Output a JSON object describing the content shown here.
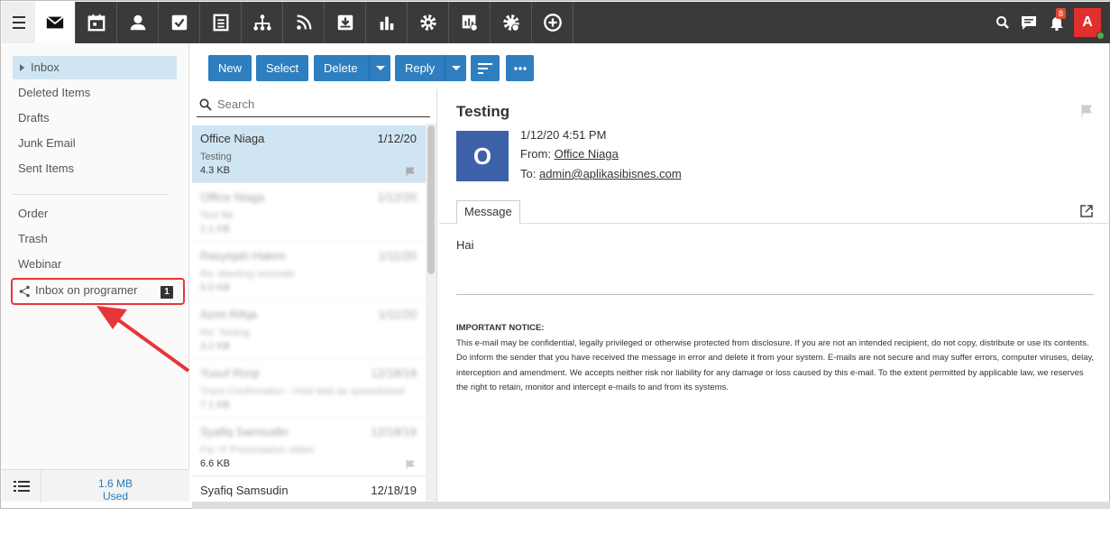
{
  "topbar": {
    "apps": [
      "mail-icon",
      "calendar-icon",
      "contacts-icon",
      "tasks-icon",
      "notes-icon",
      "org-chart-icon",
      "rss-icon",
      "archive-icon",
      "reports-icon",
      "settings-icon",
      "analytics-icon",
      "admin-settings-icon",
      "add-icon"
    ],
    "notification_count": "8",
    "user_initial": "A"
  },
  "folders": {
    "inbox": "Inbox",
    "deleted": "Deleted Items",
    "drafts": "Drafts",
    "junk": "Junk Email",
    "sent": "Sent Items",
    "order": "Order",
    "trash": "Trash",
    "webinar": "Webinar",
    "shared_inbox": "Inbox on programer",
    "shared_count": "1"
  },
  "quota": {
    "size": "1.6 MB",
    "label": "Used"
  },
  "toolbar": {
    "new": "New",
    "select": "Select",
    "delete": "Delete",
    "reply": "Reply"
  },
  "search": {
    "placeholder": "Search"
  },
  "messages": [
    {
      "from": "Office Niaga",
      "date": "1/12/20",
      "subject": "Testing",
      "size": "4.3 KB"
    },
    {
      "from": "Office Niaga",
      "date": "1/12/20",
      "subject": "Test file",
      "size": "2.1 KB"
    },
    {
      "from": "Rasyiqah Hakim",
      "date": "1/11/20",
      "subject": "Re: Meeting reminder",
      "size": "5.0 KB"
    },
    {
      "from": "Azmi Rifqa",
      "date": "1/11/20",
      "subject": "Re: Testing",
      "size": "3.2 KB"
    },
    {
      "from": "Yusuf Rizqi",
      "date": "12/18/19",
      "subject": "Trans Confirmation - Hold Mail as spreadsheet",
      "size": "7.1 KB"
    },
    {
      "from": "Syafiq Samsudin",
      "date": "12/18/19",
      "subject": "Fw: IT Presentation slides",
      "size": "6.6 KB"
    },
    {
      "from": "Syafiq Samsudin",
      "date": "12/18/19",
      "subject": "",
      "size": ""
    }
  ],
  "reading": {
    "subject": "Testing",
    "avatar": "O",
    "datetime": "1/12/20 4:51 PM",
    "from_label": "From:",
    "from": "Office Niaga",
    "to_label": "To:",
    "to": "admin@aplikasibisnes.com",
    "tab": "Message",
    "body": "Hai",
    "notice_title": "IMPORTANT NOTICE:",
    "notice_text": "This e-mail may be confidential, legally privileged or otherwise protected from disclosure. If you are not an intended recipient, do not copy, distribute or use its contents. Do inform the sender that you have received the message in error and delete it from your system. E-mails are not secure and may suffer errors, computer viruses, delay, interception and amendment. We accepts neither risk nor liability for any damage or loss caused by this e-mail. To the extent permitted by applicable law, we reserves the right to retain, monitor and intercept e-mails to and from its systems."
  },
  "colors": {
    "accent": "#2e7ec0",
    "topbar": "#3a3a3a",
    "selection": "#cfe5f4",
    "highlight": "#e8353a",
    "avatar": "#3e62a9"
  }
}
